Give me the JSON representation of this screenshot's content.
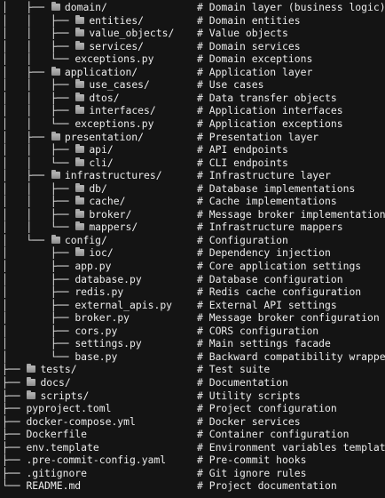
{
  "rows": [
    {
      "prefix": "│   ├── ",
      "folder": true,
      "name": "domain/",
      "comment": "# Domain layer (business logic)"
    },
    {
      "prefix": "│   │   ├── ",
      "folder": true,
      "name": "entities/",
      "comment": "# Domain entities"
    },
    {
      "prefix": "│   │   ├── ",
      "folder": true,
      "name": "value_objects/",
      "comment": "# Value objects"
    },
    {
      "prefix": "│   │   ├── ",
      "folder": true,
      "name": "services/",
      "comment": "# Domain services"
    },
    {
      "prefix": "│   │   └── ",
      "folder": false,
      "name": "exceptions.py",
      "comment": "# Domain exceptions"
    },
    {
      "prefix": "│   ├── ",
      "folder": true,
      "name": "application/",
      "comment": "# Application layer"
    },
    {
      "prefix": "│   │   ├── ",
      "folder": true,
      "name": "use_cases/",
      "comment": "# Use cases"
    },
    {
      "prefix": "│   │   ├── ",
      "folder": true,
      "name": "dtos/",
      "comment": "# Data transfer objects"
    },
    {
      "prefix": "│   │   ├── ",
      "folder": true,
      "name": "interfaces/",
      "comment": "# Application interfaces"
    },
    {
      "prefix": "│   │   └── ",
      "folder": false,
      "name": "exceptions.py",
      "comment": "# Application exceptions"
    },
    {
      "prefix": "│   ├── ",
      "folder": true,
      "name": "presentation/",
      "comment": "# Presentation layer"
    },
    {
      "prefix": "│   │   ├── ",
      "folder": true,
      "name": "api/",
      "comment": "# API endpoints"
    },
    {
      "prefix": "│   │   └── ",
      "folder": true,
      "name": "cli/",
      "comment": "# CLI endpoints"
    },
    {
      "prefix": "│   ├── ",
      "folder": true,
      "name": "infrastructures/",
      "comment": "# Infrastructure layer"
    },
    {
      "prefix": "│   │   ├── ",
      "folder": true,
      "name": "db/",
      "comment": "# Database implementations"
    },
    {
      "prefix": "│   │   ├── ",
      "folder": true,
      "name": "cache/",
      "comment": "# Cache implementations"
    },
    {
      "prefix": "│   │   ├── ",
      "folder": true,
      "name": "broker/",
      "comment": "# Message broker implementations"
    },
    {
      "prefix": "│   │   └── ",
      "folder": true,
      "name": "mappers/",
      "comment": "# Infrastructure mappers"
    },
    {
      "prefix": "│   └── ",
      "folder": true,
      "name": "config/",
      "comment": "# Configuration"
    },
    {
      "prefix": "│       ├── ",
      "folder": true,
      "name": "ioc/",
      "comment": "# Dependency injection"
    },
    {
      "prefix": "│       ├── ",
      "folder": false,
      "name": "app.py",
      "comment": "# Core application settings"
    },
    {
      "prefix": "│       ├── ",
      "folder": false,
      "name": "database.py",
      "comment": "# Database configuration"
    },
    {
      "prefix": "│       ├── ",
      "folder": false,
      "name": "redis.py",
      "comment": "# Redis cache configuration"
    },
    {
      "prefix": "│       ├── ",
      "folder": false,
      "name": "external_apis.py",
      "comment": "# External API settings"
    },
    {
      "prefix": "│       ├── ",
      "folder": false,
      "name": "broker.py",
      "comment": "# Message broker configuration"
    },
    {
      "prefix": "│       ├── ",
      "folder": false,
      "name": "cors.py",
      "comment": "# CORS configuration"
    },
    {
      "prefix": "│       ├── ",
      "folder": false,
      "name": "settings.py",
      "comment": "# Main settings facade"
    },
    {
      "prefix": "│       └── ",
      "folder": false,
      "name": "base.py",
      "comment": "# Backward compatibility wrapper"
    },
    {
      "prefix": "├── ",
      "folder": true,
      "name": "tests/",
      "comment": "# Test suite"
    },
    {
      "prefix": "├── ",
      "folder": true,
      "name": "docs/",
      "comment": "# Documentation"
    },
    {
      "prefix": "├── ",
      "folder": true,
      "name": "scripts/",
      "comment": "# Utility scripts"
    },
    {
      "prefix": "├── ",
      "folder": false,
      "name": "pyproject.toml",
      "comment": "# Project configuration"
    },
    {
      "prefix": "├── ",
      "folder": false,
      "name": "docker-compose.yml",
      "comment": "# Docker services"
    },
    {
      "prefix": "├── ",
      "folder": false,
      "name": "Dockerfile",
      "comment": "# Container configuration"
    },
    {
      "prefix": "├── ",
      "folder": false,
      "name": "env.template",
      "comment": "# Environment variables template"
    },
    {
      "prefix": "├── ",
      "folder": false,
      "name": ".pre-commit-config.yaml",
      "comment": "# Pre-commit hooks"
    },
    {
      "prefix": "├── ",
      "folder": false,
      "name": ".gitignore",
      "comment": "# Git ignore rules"
    },
    {
      "prefix": "└── ",
      "folder": false,
      "name": "README.md",
      "comment": "# Project documentation"
    }
  ],
  "icons": {
    "folder": "folder-icon"
  },
  "colors": {
    "background": "#141414",
    "text": "#ececec",
    "folder": "#a9a9a9"
  }
}
